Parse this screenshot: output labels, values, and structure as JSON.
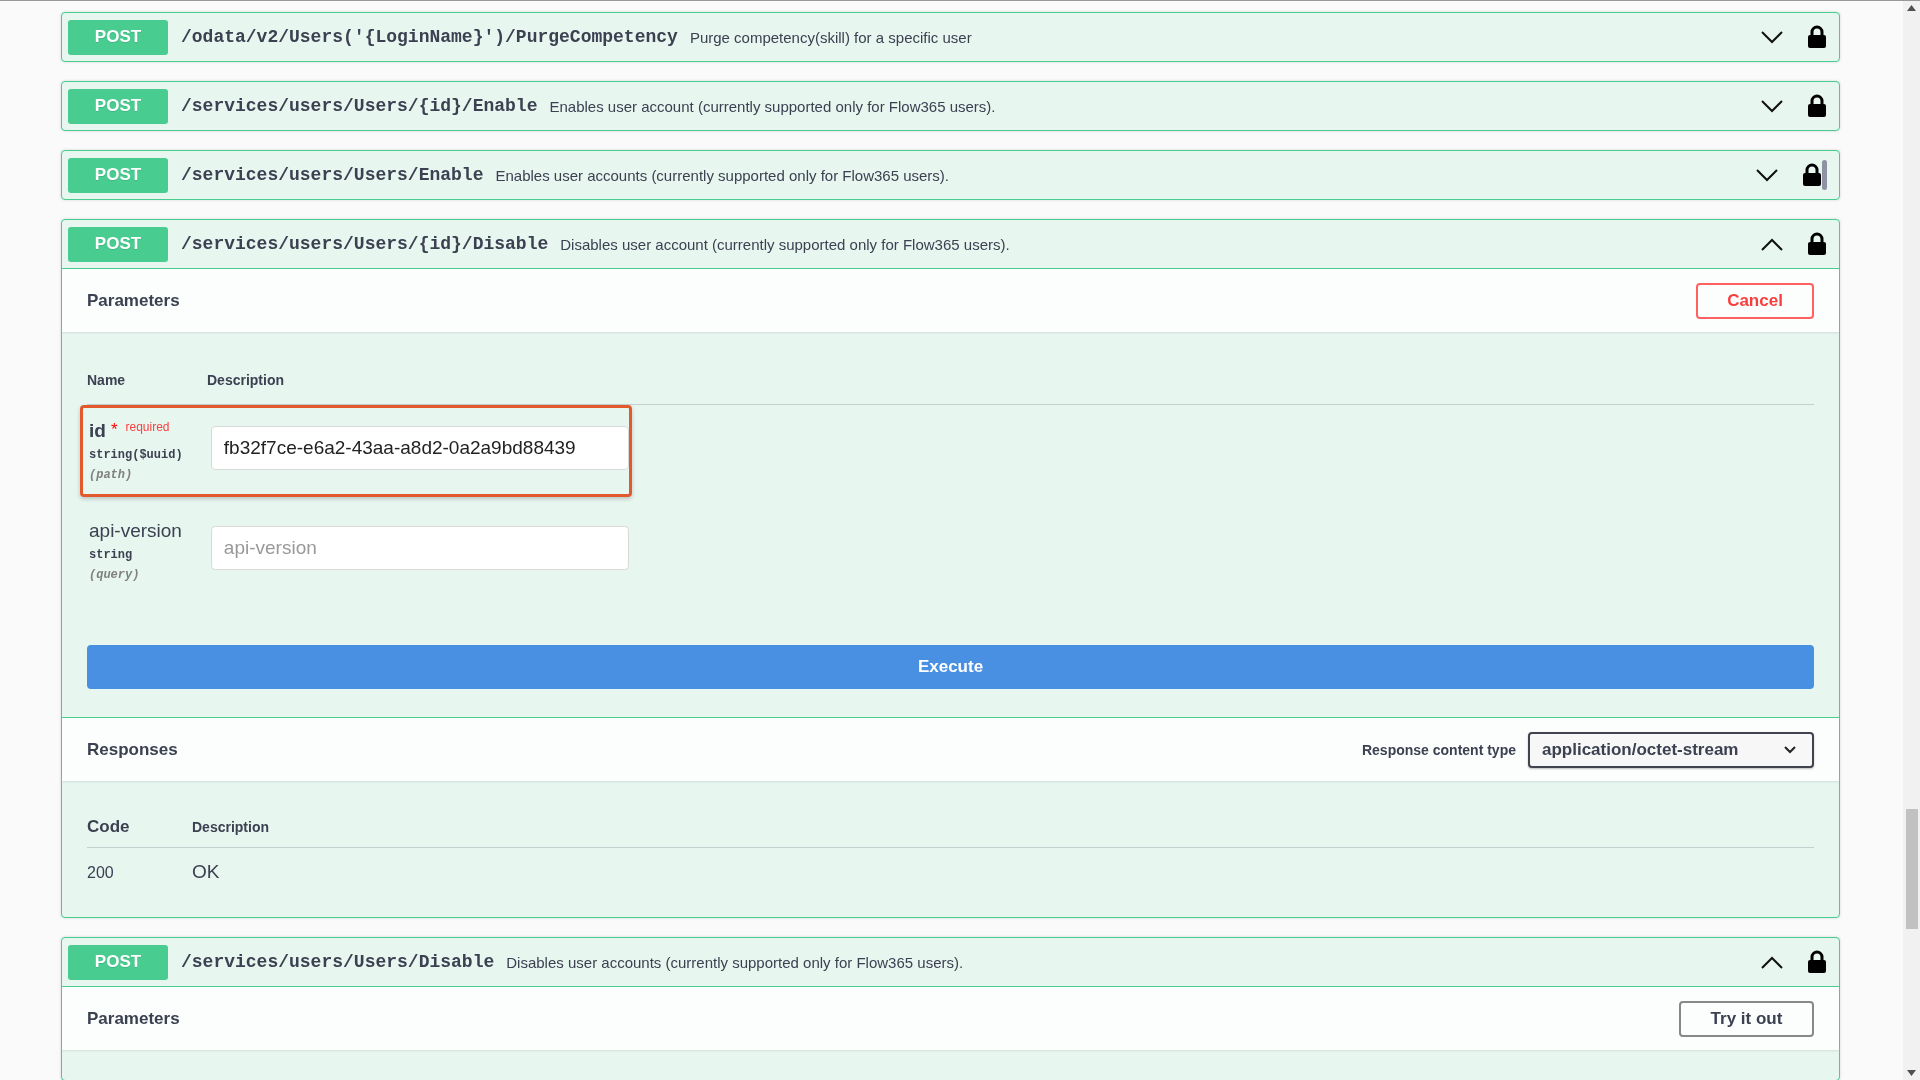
{
  "operations": [
    {
      "method": "POST",
      "path": "/odata/v2/Users('{LoginName}')/PurgeCompetency",
      "summary": "Purge competency(skill) for a specific user",
      "expanded": false,
      "locked": true,
      "handle": false
    },
    {
      "method": "POST",
      "path": "/services/users/Users/{id}/Enable",
      "summary": "Enables user account (currently supported only for Flow365 users).",
      "expanded": false,
      "locked": true,
      "handle": false
    },
    {
      "method": "POST",
      "path": "/services/users/Users/Enable",
      "summary": "Enables user accounts (currently supported only for Flow365 users).",
      "expanded": false,
      "locked": true,
      "handle": true
    },
    {
      "method": "POST",
      "path": "/services/users/Users/{id}/Disable",
      "summary": "Disables user account (currently supported only for Flow365 users).",
      "expanded": true,
      "locked": true,
      "handle": false,
      "parameters": {
        "title": "Parameters",
        "button": {
          "label": "Cancel",
          "kind": "cancel"
        },
        "columns": [
          "Name",
          "Description"
        ],
        "rows": [
          {
            "name": "id",
            "required_mark": "*",
            "required_label": "required",
            "type": "string($uuid)",
            "location": "(path)",
            "value": "fb32f7ce-e6a2-43aa-a8d2-0a2a9bd88439",
            "highlighted": true
          },
          {
            "name": "api-version",
            "type": "string",
            "location": "(query)",
            "placeholder": "api-version",
            "highlighted": false
          }
        ],
        "execute": "Execute"
      },
      "responses": {
        "title": "Responses",
        "content_type_label": "Response content type",
        "content_type": "application/octet-stream",
        "columns": [
          "Code",
          "Description"
        ],
        "rows": [
          {
            "code": "200",
            "description": "OK"
          }
        ]
      }
    },
    {
      "method": "POST",
      "path": "/services/users/Users/Disable",
      "summary": "Disables user accounts (currently supported only for Flow365 users).",
      "expanded": true,
      "locked": true,
      "handle": false,
      "parameters": {
        "title": "Parameters",
        "button": {
          "label": "Try it out",
          "kind": "try"
        }
      }
    }
  ]
}
